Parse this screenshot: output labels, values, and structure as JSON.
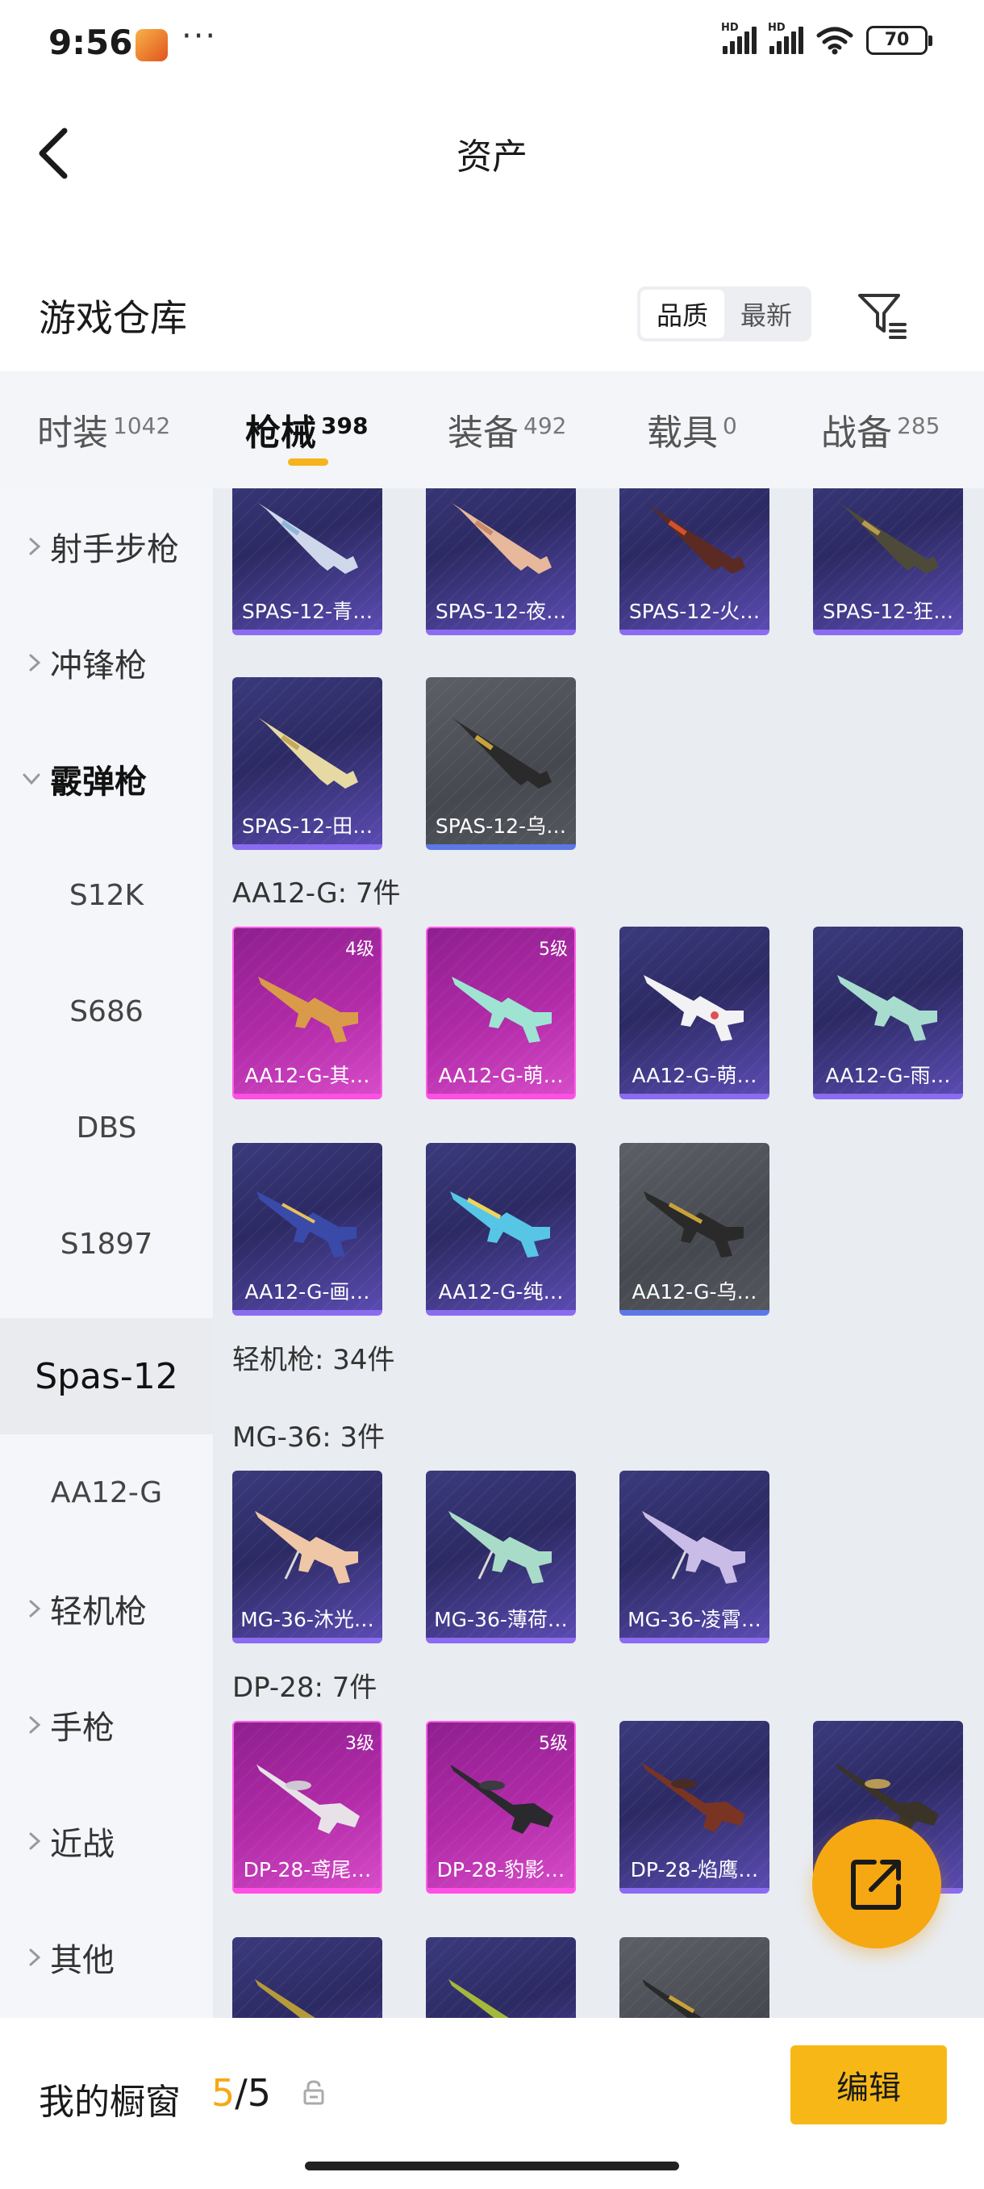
{
  "status_bar": {
    "time": "9:56",
    "more": "···",
    "battery": "70"
  },
  "nav": {
    "title": "资产"
  },
  "header": {
    "section_title": "游戏仓库",
    "sort_options": [
      "品质",
      "最新"
    ],
    "sort_active": "品质"
  },
  "tabs": [
    {
      "label": "时装",
      "count": "1042"
    },
    {
      "label": "枪械",
      "count": "398"
    },
    {
      "label": "装备",
      "count": "492"
    },
    {
      "label": "载具",
      "count": "0"
    },
    {
      "label": "战备",
      "count": "285"
    }
  ],
  "sidebar": {
    "items": [
      {
        "label": "射手步枪"
      },
      {
        "label": "冲锋枪"
      },
      {
        "label": "霰弹枪"
      },
      {
        "label": "S12K"
      },
      {
        "label": "S686"
      },
      {
        "label": "DBS"
      },
      {
        "label": "S1897"
      },
      {
        "label": "Spas-12"
      },
      {
        "label": "AA12-G"
      },
      {
        "label": "轻机枪"
      },
      {
        "label": "手枪"
      },
      {
        "label": "近战"
      },
      {
        "label": "其他"
      }
    ]
  },
  "content": {
    "row1": [
      "SPAS-12-青…",
      "SPAS-12-夜…",
      "SPAS-12-火…",
      "SPAS-12-狂…"
    ],
    "row2": [
      "SPAS-12-田…",
      "SPAS-12-乌…"
    ],
    "aa12_title": "AA12-G: 7件",
    "aa12": [
      {
        "name": "AA12-G-其…",
        "level": "4级"
      },
      {
        "name": "AA12-G-萌…",
        "level": "5级"
      },
      {
        "name": "AA12-G-萌…",
        "level": ""
      },
      {
        "name": "AA12-G-雨…",
        "level": ""
      },
      {
        "name": "AA12-G-画…",
        "level": ""
      },
      {
        "name": "AA12-G-纯…",
        "level": ""
      },
      {
        "name": "AA12-G-乌…",
        "level": ""
      }
    ],
    "lmg_title": "轻机枪: 34件",
    "mg36_title": "MG-36: 3件",
    "mg36": [
      "MG-36-沐光…",
      "MG-36-薄荷…",
      "MG-36-凌霄…"
    ],
    "dp28_title": "DP-28: 7件",
    "dp28": [
      {
        "name": "DP-28-鸢尾…",
        "level": "3级"
      },
      {
        "name": "DP-28-豹影…",
        "level": "5级"
      },
      {
        "name": "DP-28-焰鹰…",
        "level": ""
      },
      {
        "name": "",
        "level": ""
      }
    ]
  },
  "bottom": {
    "label": "我的橱窗",
    "current": "5",
    "total": "5",
    "separator": "/",
    "edit": "编辑"
  },
  "colors": {
    "accent": "#f6b31c",
    "purple_card": "#2c2a63",
    "pink_card": "#b22ba8",
    "gray_card": "#46484f"
  }
}
